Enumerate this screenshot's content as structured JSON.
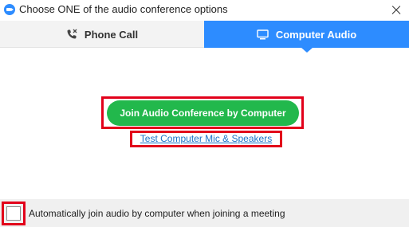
{
  "window": {
    "title": "Choose ONE of the audio conference options",
    "app_icon": "zoom-camera-icon",
    "close_icon": "close-icon"
  },
  "tabs": [
    {
      "label": "Phone Call",
      "icon": "phone-icon",
      "selected": false
    },
    {
      "label": "Computer Audio",
      "icon": "monitor-icon",
      "selected": true
    }
  ],
  "main": {
    "join_button_label": "Join Audio Conference by Computer",
    "test_link_label": "Test Computer Mic & Speakers"
  },
  "footer": {
    "auto_join_label": "Automatically join audio by computer when joining a meeting",
    "auto_join_checked": false
  },
  "colors": {
    "accent_blue": "#2d8cff",
    "join_green": "#22b84c",
    "highlight_red": "#e2001a",
    "link_blue": "#1a73c8"
  }
}
